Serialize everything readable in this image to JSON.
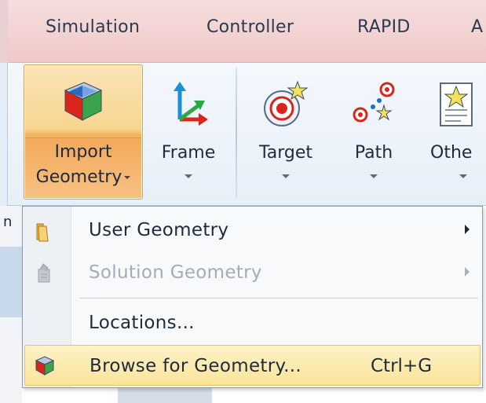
{
  "tabs": [
    {
      "label": "Simulation"
    },
    {
      "label": "Controller"
    },
    {
      "label": "RAPID"
    },
    {
      "label": "A"
    }
  ],
  "ribbon": {
    "import_line1": "Import",
    "import_line2": "Geometry",
    "frame": "Frame",
    "target": "Target",
    "path": "Path",
    "other": "Othe",
    "icons": {
      "import": "geometry-cube-icon",
      "frame": "coordinate-frame-icon",
      "target": "target-icon",
      "path": "path-icon",
      "other": "other-document-icon"
    }
  },
  "menu": {
    "items": [
      {
        "label": "User Geometry",
        "icon": "folder-icon",
        "enabled": true,
        "submenu": true
      },
      {
        "label": "Solution Geometry",
        "icon": "solution-library-icon",
        "enabled": false,
        "submenu": true
      },
      {
        "label": "Locations...",
        "icon": "",
        "enabled": true,
        "submenu": false
      },
      {
        "label": "Browse for Geometry...",
        "icon": "geometry-cube-icon",
        "enabled": true,
        "submenu": false,
        "shortcut": "Ctrl+G",
        "highlighted": true
      }
    ]
  },
  "background": {
    "left_fragment": "n"
  },
  "colors": {
    "tab_bar": "#f0c8c8",
    "ribbon": "#eaf1f9",
    "import_button": "#f5b766",
    "menu_highlight": "#fbe49a"
  }
}
